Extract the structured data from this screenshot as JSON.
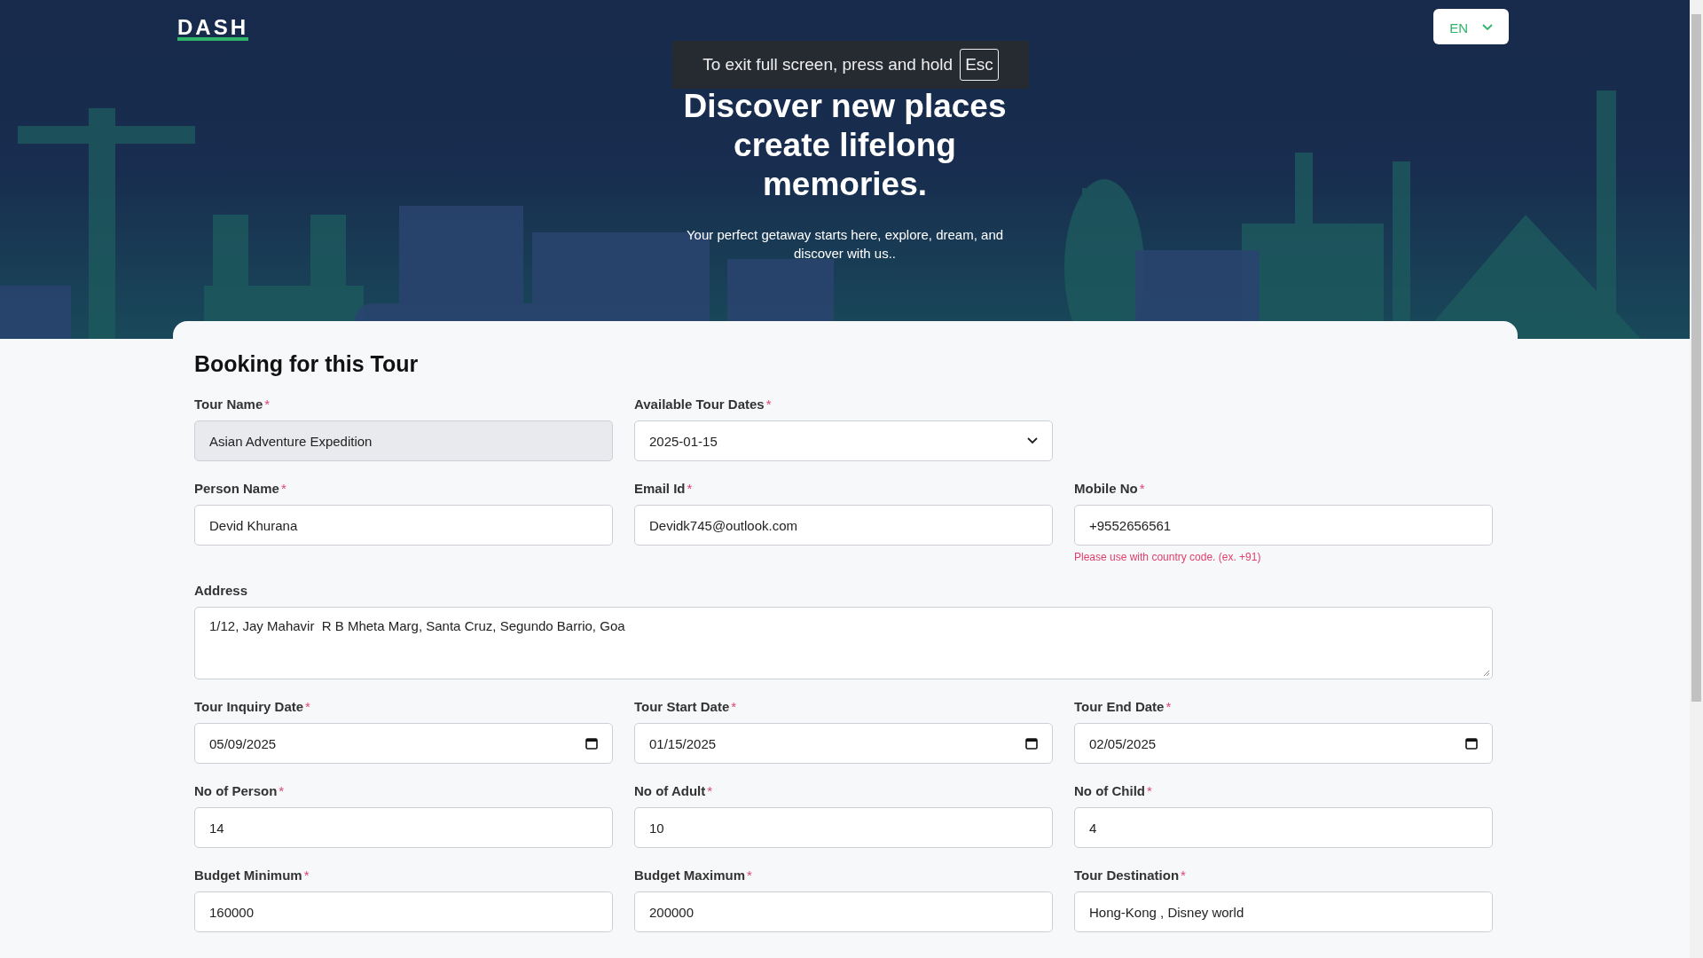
{
  "header": {
    "logo": "DASH",
    "language": {
      "value": "EN"
    },
    "fullscreen_notice": {
      "text": "To exit full screen, press and hold",
      "key": "Esc"
    },
    "title_lines": [
      "Discover new places",
      "create lifelong",
      "memories."
    ],
    "subtitle": "Your perfect getaway starts here, explore, dream, and discover with us.."
  },
  "form": {
    "title": "Booking for this Tour",
    "rows": [
      [
        {
          "kind": "text",
          "label": "Tour Name",
          "required_mark": "*",
          "value": "Asian Adventure Expedition",
          "disabled": true
        },
        {
          "kind": "select",
          "label": "Available Tour Dates",
          "required_mark": "*",
          "value": "2025-01-15",
          "disabled": false
        }
      ],
      [
        {
          "kind": "text",
          "label": "Person Name",
          "required_mark": "*",
          "value": "Devid Khurana",
          "disabled": false
        },
        {
          "kind": "text",
          "label": "Email Id",
          "required_mark": "*",
          "value": "Devidk745@outlook.com",
          "disabled": false
        },
        {
          "kind": "text",
          "label": "Mobile No",
          "required_mark": "*",
          "value": "+9552656561",
          "disabled": false,
          "hint": "Please use with country code. (ex. +91)"
        }
      ],
      [
        {
          "kind": "textarea",
          "label": "Address",
          "value": "1/12, Jay Mahavir  R B Mheta Marg, Santa Cruz, Segundo Barrio, Goa",
          "disabled": false
        }
      ],
      [
        {
          "kind": "date",
          "label": "Tour Inquiry Date",
          "required_mark": "*",
          "value": "05/09/2025",
          "disabled": false
        },
        {
          "kind": "date",
          "label": "Tour Start Date",
          "required_mark": "*",
          "value": "01/15/2025",
          "disabled": false
        },
        {
          "kind": "date",
          "label": "Tour End Date",
          "required_mark": "*",
          "value": "02/05/2025",
          "disabled": false
        }
      ],
      [
        {
          "kind": "text",
          "label": "No of Person",
          "required_mark": "*",
          "value": "14",
          "disabled": false
        },
        {
          "kind": "text",
          "label": "No of Adult",
          "required_mark": "*",
          "value": "10",
          "disabled": false
        },
        {
          "kind": "text",
          "label": "No of Child",
          "required_mark": "*",
          "value": "4",
          "disabled": false
        }
      ],
      [
        {
          "kind": "text",
          "label": "Budget Minimum",
          "required_mark": "*",
          "value": "160000",
          "disabled": false
        },
        {
          "kind": "text",
          "label": "Budget Maximum",
          "required_mark": "*",
          "value": "200000",
          "disabled": false
        },
        {
          "kind": "text",
          "label": "Tour Destination",
          "required_mark": "*",
          "value": "Hong-Kong , Disney world",
          "disabled": false
        }
      ]
    ]
  }
}
